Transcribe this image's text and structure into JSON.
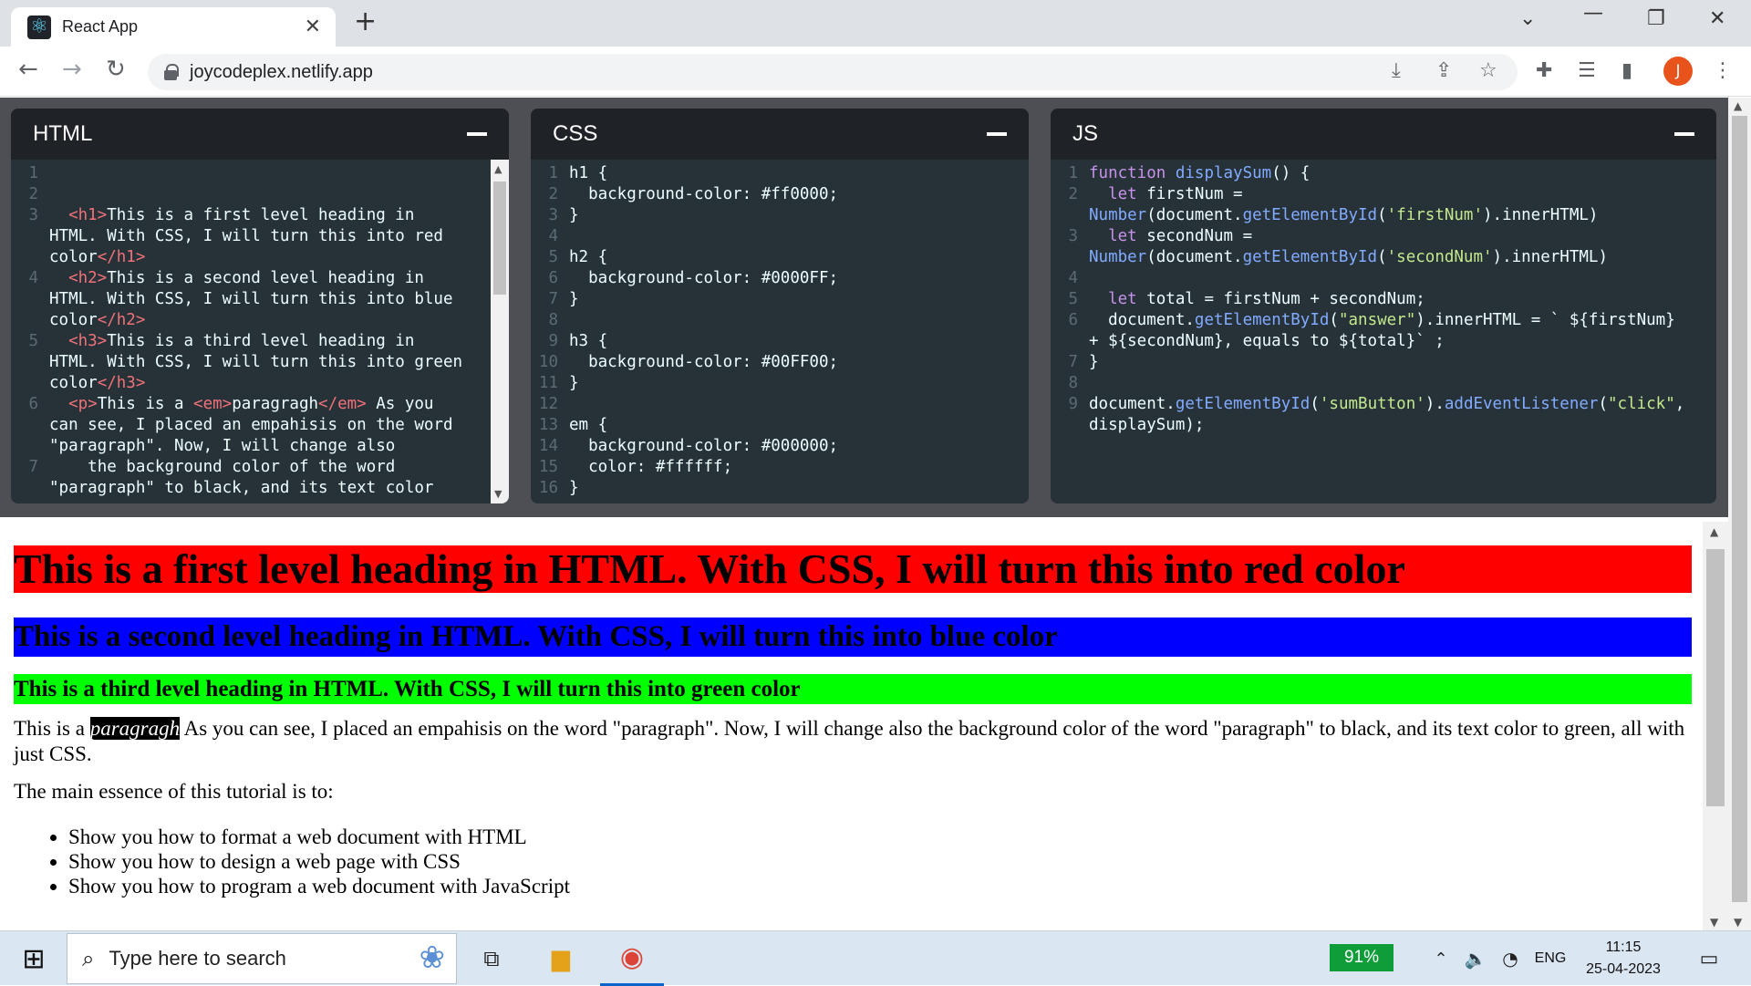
{
  "browser": {
    "tab_title": "React App",
    "url": "joycodeplex.netlify.app",
    "profile_initial": "J"
  },
  "editors": {
    "html": {
      "title": "HTML",
      "lines": [
        {
          "n": "1",
          "text": ""
        },
        {
          "n": "2",
          "text": ""
        },
        {
          "n": "3",
          "text": "  <h1>This is a first level heading in\nHTML. With CSS, I will turn this into red\ncolor</h1>"
        },
        {
          "n": "4",
          "text": "  <h2>This is a second level heading in\nHTML. With CSS, I will turn this into blue\ncolor</h2>"
        },
        {
          "n": "5",
          "text": "  <h3>This is a third level heading in\nHTML. With CSS, I will turn this into green\ncolor</h3>"
        },
        {
          "n": "6",
          "text": "  <p>This is a <em>paragragh</em> As you\ncan see, I placed an empahisis on the word\n\"paragraph\". Now, I will change also"
        },
        {
          "n": "7",
          "text": "    the background color of the word\n\"paragraph\" to black, and its text color"
        }
      ]
    },
    "css": {
      "title": "CSS",
      "lines": [
        {
          "n": "1",
          "text": "h1 {"
        },
        {
          "n": "2",
          "text": "  background-color: #ff0000;"
        },
        {
          "n": "3",
          "text": "}"
        },
        {
          "n": "4",
          "text": ""
        },
        {
          "n": "5",
          "text": "h2 {"
        },
        {
          "n": "6",
          "text": "  background-color: #0000FF;"
        },
        {
          "n": "7",
          "text": "}"
        },
        {
          "n": "8",
          "text": ""
        },
        {
          "n": "9",
          "text": "h3 {"
        },
        {
          "n": "10",
          "text": "  background-color: #00FF00;"
        },
        {
          "n": "11",
          "text": "}"
        },
        {
          "n": "12",
          "text": ""
        },
        {
          "n": "13",
          "text": "em {"
        },
        {
          "n": "14",
          "text": "  background-color: #000000;"
        },
        {
          "n": "15",
          "text": "  color: #ffffff;"
        },
        {
          "n": "16",
          "text": "}"
        }
      ]
    },
    "js": {
      "title": "JS",
      "lines": [
        {
          "n": "1",
          "text": "function displaySum() {"
        },
        {
          "n": "2",
          "text": "  let firstNum =\nNumber(document.getElementById('firstNum').innerHTML)"
        },
        {
          "n": "3",
          "text": "  let secondNum =\nNumber(document.getElementById('secondNum').innerHTML)"
        },
        {
          "n": "4",
          "text": ""
        },
        {
          "n": "5",
          "text": "  let total = firstNum + secondNum;"
        },
        {
          "n": "6",
          "text": "  document.getElementById(\"answer\").innerHTML = ` ${firstNum}\n+ ${secondNum}, equals to ${total}` ;"
        },
        {
          "n": "7",
          "text": "}"
        },
        {
          "n": "8",
          "text": ""
        },
        {
          "n": "9",
          "text": "document.getElementById('sumButton').addEventListener(\"click\",\ndisplaySum);"
        }
      ]
    }
  },
  "preview": {
    "h1": "This is a first level heading in HTML. With CSS, I will turn this into red color",
    "h2": "This is a second level heading in HTML. With CSS, I will turn this into blue color",
    "h3": "This is a third level heading in HTML. With CSS, I will turn this into green color",
    "para_before": "This is a ",
    "para_em": "paragragh",
    "para_after": " As you can see, I placed an empahisis on the word \"paragraph\". Now, I will change also the background color of the word \"paragraph\" to black, and its text color to green, all with just CSS.",
    "essence": "The main essence of this tutorial is to:",
    "list": [
      "Show you how to format a web document with HTML",
      "Show you how to design a web page with CSS",
      "Show you how to program a web document with JavaScript"
    ]
  },
  "taskbar": {
    "search_placeholder": "Type here to search",
    "battery": "91%",
    "language": "ENG",
    "time": "11:15",
    "date": "25-04-2023"
  },
  "colors": {
    "h1_bg": "#ff0000",
    "h2_bg": "#0000ff",
    "h3_bg": "#00ff00",
    "editor_bg": "#263238",
    "panel_header": "#1f2226"
  }
}
